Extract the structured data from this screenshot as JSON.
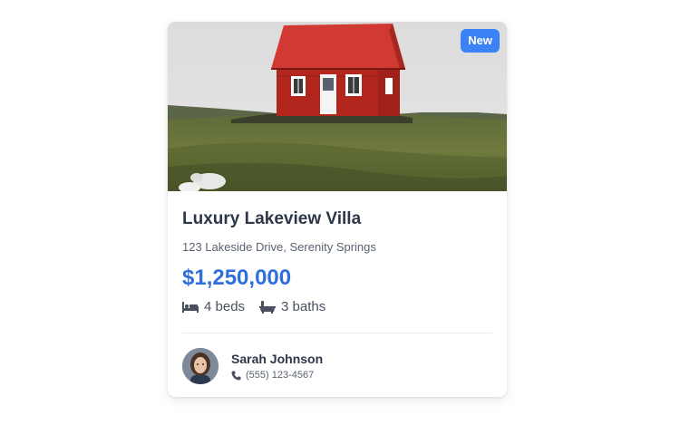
{
  "listing": {
    "badge": "New",
    "title": "Luxury Lakeview Villa",
    "address": "123 Lakeside Drive, Serenity Springs",
    "price": "$1,250,000",
    "features": [
      {
        "icon": "bed-icon",
        "label": "4 beds"
      },
      {
        "icon": "bath-icon",
        "label": "3 baths"
      }
    ],
    "image": "red-house-on-hill-photo"
  },
  "agent": {
    "name": "Sarah Johnson",
    "phone": "(555) 123-4567",
    "phone_icon": "phone-icon"
  },
  "colors": {
    "accent": "#3b82f6",
    "price": "#2f6fdc",
    "title": "#2d3748",
    "muted": "#5a6270"
  }
}
